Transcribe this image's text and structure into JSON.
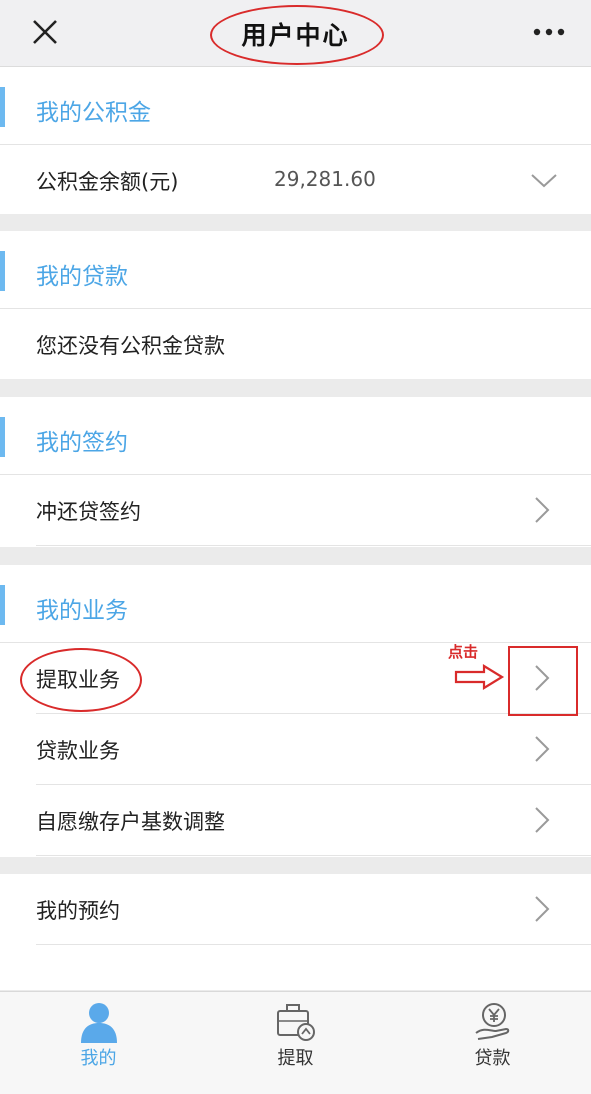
{
  "header": {
    "title": "用户中心"
  },
  "sections": {
    "fund": {
      "title": "我的公积金",
      "balance_label": "公积金余额(元)",
      "balance_value": "29,281.60"
    },
    "loan": {
      "title": "我的贷款",
      "empty_text": "您还没有公积金贷款"
    },
    "sign": {
      "title": "我的签约",
      "item": "冲还贷签约"
    },
    "business": {
      "title": "我的业务",
      "items": [
        "提取业务",
        "贷款业务",
        "自愿缴存户基数调整"
      ]
    },
    "reserve": {
      "item": "我的预约"
    }
  },
  "annotation": {
    "click_text": "点击",
    "color": "#d92b2b"
  },
  "tabbar": {
    "tabs": [
      {
        "label": "我的",
        "icon": "user-icon",
        "active": true
      },
      {
        "label": "提取",
        "icon": "withdraw-icon",
        "active": false
      },
      {
        "label": "贷款",
        "icon": "loan-icon",
        "active": false
      }
    ]
  },
  "colors": {
    "accent": "#4ca6e6",
    "section_bar": "#6db9f0"
  }
}
